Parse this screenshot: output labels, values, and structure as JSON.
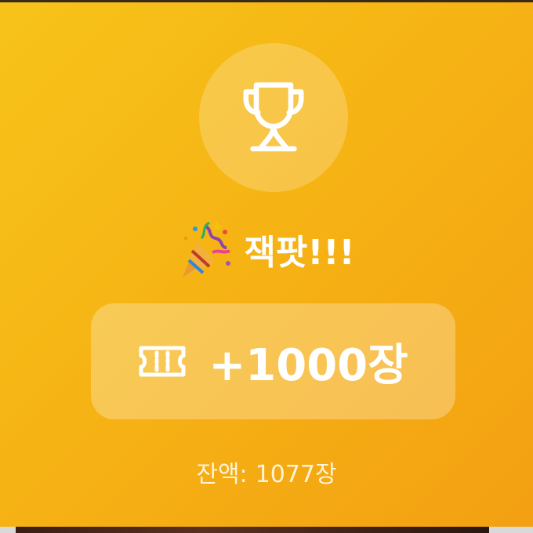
{
  "result": {
    "trophy_icon": "trophy-icon",
    "party_icon": "party-popper-icon",
    "title": "잭팟!!!",
    "reward_icon": "ticket-icon",
    "reward_amount": "+1000장",
    "balance_label": "잔액:",
    "balance_value": "1077장"
  },
  "colors": {
    "background_start": "#f7c31a",
    "background_end": "#f3a012",
    "text": "#ffffff"
  }
}
